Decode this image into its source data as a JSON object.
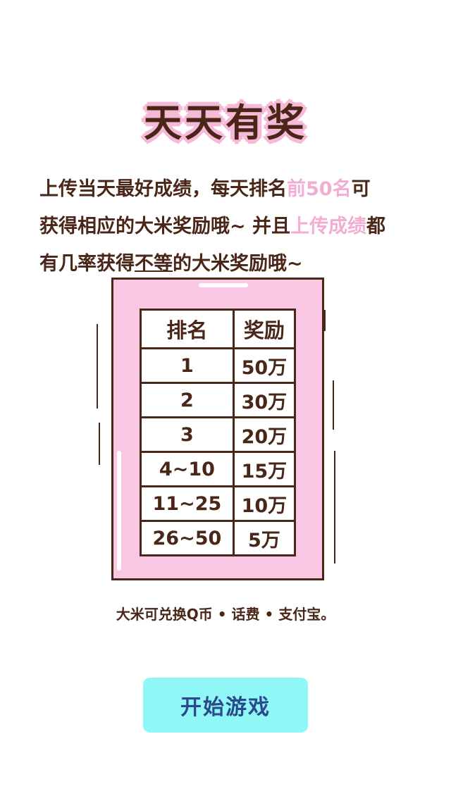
{
  "title": "天天有奖",
  "description": {
    "line1_a": "上传当天最好成绩，每天排名",
    "line1_hl": "前50名",
    "line1_b": "可",
    "line2_a": "获得相应的大米奖励哦~ 并且",
    "line2_hl": "上传成绩",
    "line2_b": "都",
    "line3_a": "有几率获得",
    "line3_ul": "不等",
    "line3_b": "的大米奖励哦~"
  },
  "reward_table": {
    "headers": [
      "排名",
      "奖励"
    ],
    "rows": [
      [
        "1",
        "50万"
      ],
      [
        "2",
        "30万"
      ],
      [
        "3",
        "20万"
      ],
      [
        "4~10",
        "15万"
      ],
      [
        "11~25",
        "10万"
      ],
      [
        "26~50",
        "5万"
      ]
    ]
  },
  "note": "大米可兑换Q币 • 话费 • 支付宝。",
  "start_button": "开始游戏",
  "colors": {
    "text": "#4a2618",
    "highlight": "#f2aed2",
    "card": "#f9c6e3",
    "button": "#8ff7f6",
    "button_text": "#2a4a8a"
  }
}
